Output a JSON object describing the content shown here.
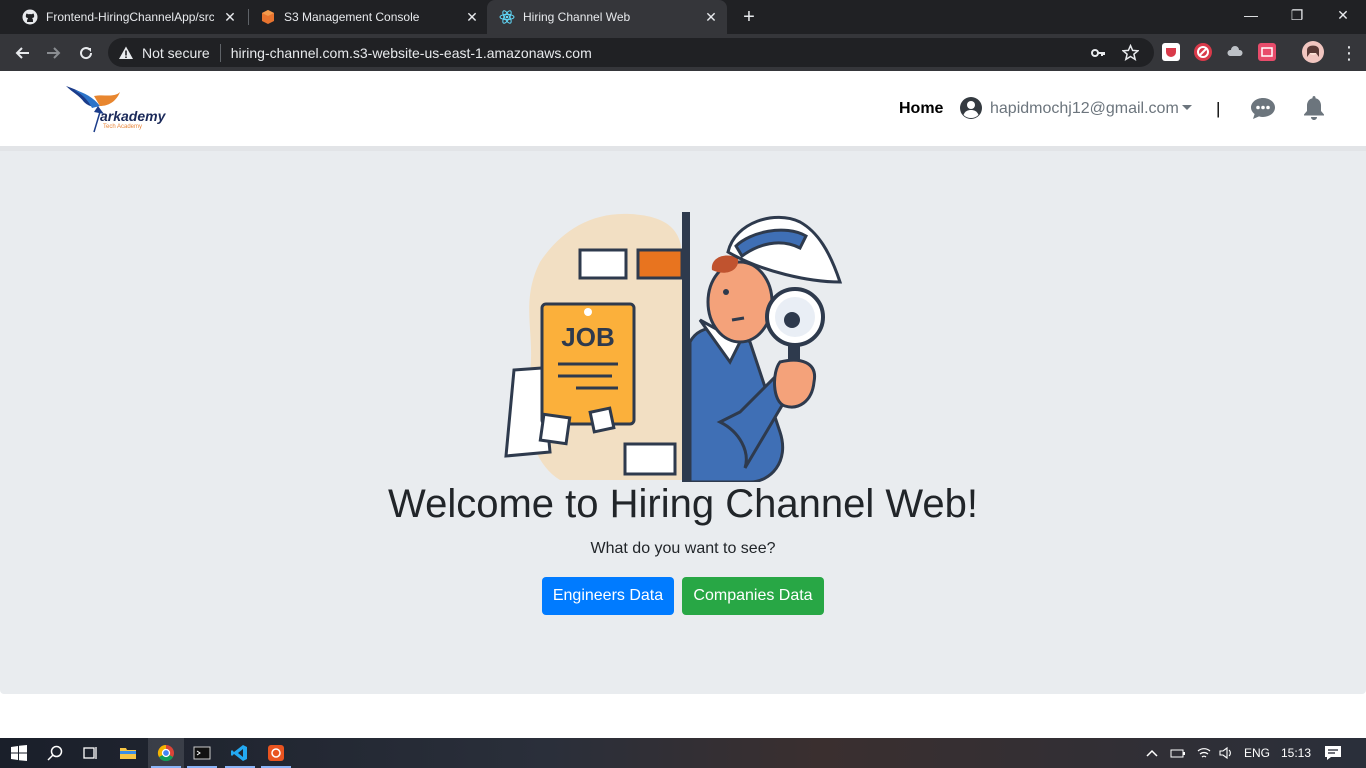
{
  "browser": {
    "tabs": [
      {
        "title": "Frontend-HiringChannelApp/src/",
        "icon": "github-icon"
      },
      {
        "title": "S3 Management Console",
        "icon": "aws-icon"
      },
      {
        "title": "Hiring Channel Web",
        "icon": "react-icon",
        "active": true
      }
    ],
    "address": {
      "security_label": "Not secure",
      "url": "hiring-channel.com.s3-website-us-east-1.amazonaws.com"
    }
  },
  "header": {
    "logo_text": "arkademy",
    "logo_sub": "Tech Academy",
    "nav_home": "Home",
    "user_email": "hapidmochj12@gmail.com",
    "separator": "|"
  },
  "hero": {
    "title": "Welcome to Hiring Channel Web!",
    "subtitle": "What do you want to see?",
    "illustration_text": "JOB",
    "buttons": {
      "engineers": "Engineers Data",
      "companies": "Companies Data"
    },
    "colors": {
      "engineers": "#007bff",
      "companies": "#28a745"
    }
  },
  "taskbar": {
    "language": "ENG",
    "time": "15:13"
  }
}
